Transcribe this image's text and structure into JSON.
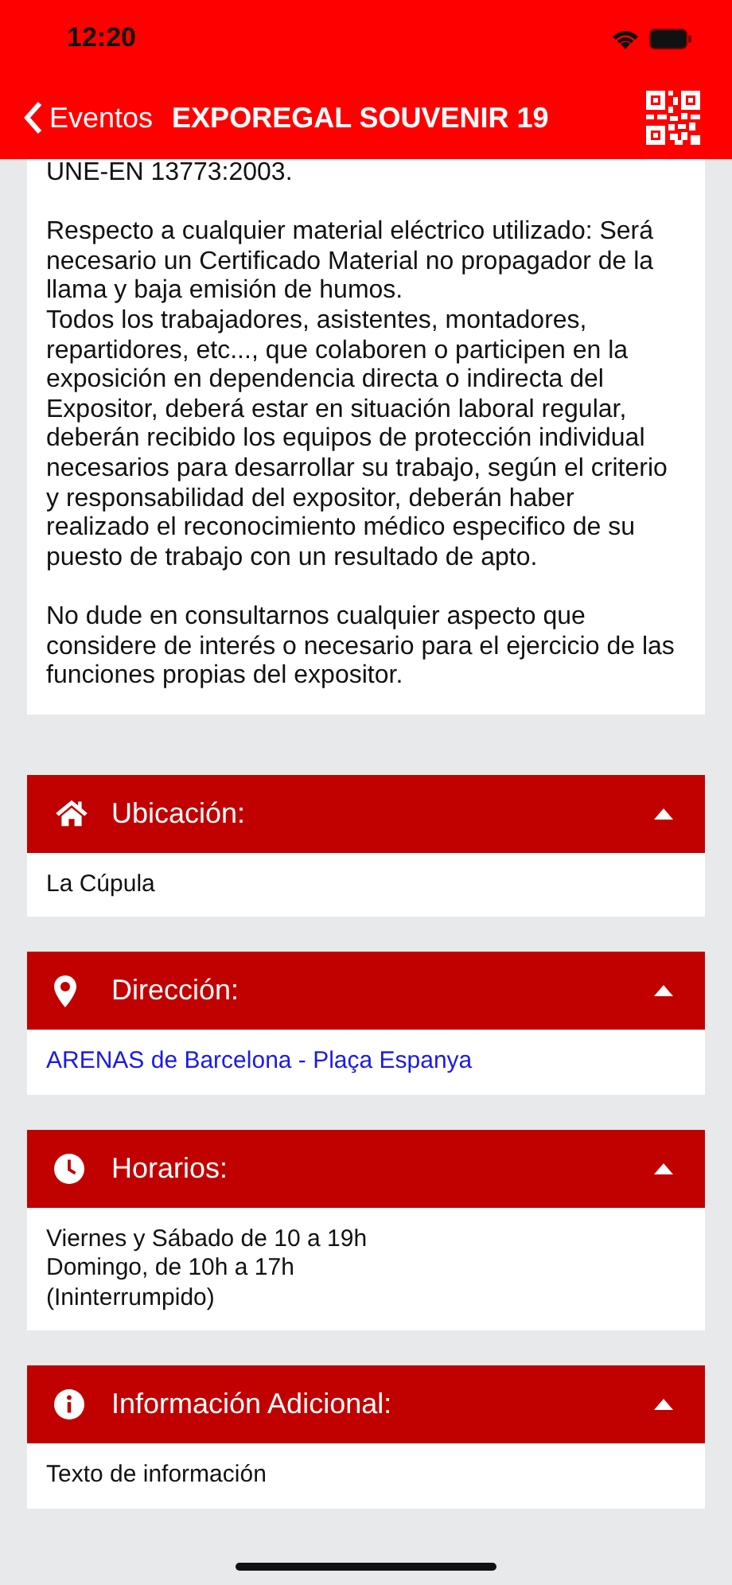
{
  "status_bar": {
    "time": "12:20"
  },
  "nav_bar": {
    "back_label": "Eventos",
    "title": "EXPOREGAL SOUVENIR 19"
  },
  "description": {
    "blocks": [
      [
        "UNE-EN 13773:2003."
      ],
      [
        "Respecto a cualquier material eléctrico utilizado: Será necesario un Certificado Material no propagador de la llama y baja emisión de humos.",
        "Todos los trabajadores, asistentes, montadores, repartidores, etc..., que colaboren o participen en la exposición en dependencia directa o indirecta del Expositor, deberá estar en situación laboral regular, deberán recibido los equipos de protección individual necesarios para desarrollar su trabajo, según el criterio y responsabilidad del expositor, deberán haber realizado el reconocimiento médico especifico de su puesto de trabajo con un resultado de apto."
      ],
      [
        "No dude en consultarnos cualquier aspecto que considere de interés o necesario para el ejercicio de las funciones propias del expositor."
      ]
    ]
  },
  "sections": [
    {
      "title": "Ubicación:",
      "expanded": true,
      "kind": "text",
      "lines": [
        "La Cúpula"
      ]
    },
    {
      "title": "Dirección:",
      "expanded": true,
      "kind": "link",
      "lines": [
        "ARENAS de Barcelona - Plaça Espanya"
      ]
    },
    {
      "title": "Horarios:",
      "expanded": true,
      "kind": "text",
      "lines": [
        "Viernes y Sábado de 10 a 19h",
        "Domingo, de 10h a 17h",
        "(Ininterrumpido)"
      ]
    },
    {
      "title": "Información Adicional:",
      "expanded": true,
      "kind": "text",
      "lines": [
        "Texto de información"
      ]
    }
  ]
}
